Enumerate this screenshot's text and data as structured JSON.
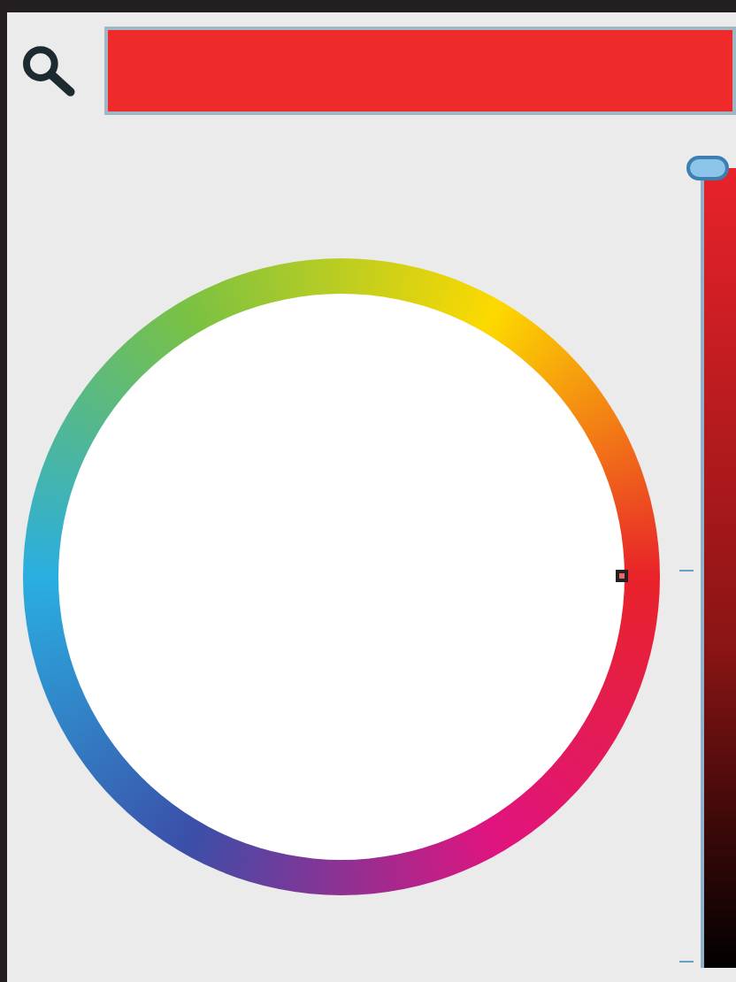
{
  "current_color": {
    "color": "#ee2a2b"
  },
  "value_slider": {
    "level": 1
  }
}
